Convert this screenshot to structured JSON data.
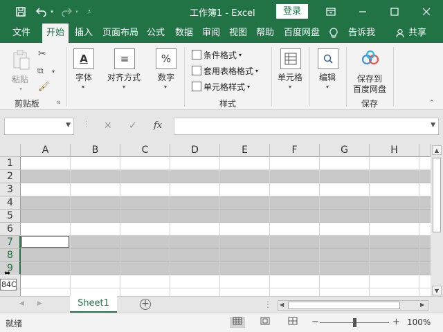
{
  "app": {
    "title": "工作簿1 - Excel",
    "login_label": "登录"
  },
  "quick_access": [
    "save-icon",
    "undo-icon",
    "redo-icon",
    "customize-icon"
  ],
  "window_controls": [
    "ribbon-display-icon",
    "minimize-icon",
    "maximize-icon",
    "close-icon"
  ],
  "tabs": [
    {
      "label": "文件"
    },
    {
      "label": "开始",
      "active": true
    },
    {
      "label": "插入"
    },
    {
      "label": "页面布局"
    },
    {
      "label": "公式"
    },
    {
      "label": "数据"
    },
    {
      "label": "审阅"
    },
    {
      "label": "视图"
    },
    {
      "label": "帮助"
    },
    {
      "label": "百度网盘"
    },
    {
      "label": "告诉我"
    },
    {
      "label": "共享"
    }
  ],
  "ribbon": {
    "clipboard": {
      "paste_label": "粘贴",
      "group_label": "剪贴板"
    },
    "font": {
      "label": "字体",
      "icon_glyph": "A"
    },
    "alignment": {
      "label": "对齐方式",
      "icon_glyph": "≡"
    },
    "number": {
      "label": "数字",
      "icon_glyph": "%"
    },
    "styles": {
      "conditional_format": "条件格式",
      "table_format": "套用表格格式",
      "cell_styles": "单元格样式",
      "group_label": "样式"
    },
    "cells": {
      "label": "单元格"
    },
    "editing": {
      "label": "编辑"
    },
    "save": {
      "label_line1": "保存到",
      "label_line2": "百度网盘",
      "group_label": "保存"
    }
  },
  "formula_bar": {
    "name_box_value": "",
    "cancel_glyph": "✕",
    "enter_glyph": "✓",
    "fx_glyph": "fx",
    "formula_value": ""
  },
  "grid": {
    "columns": [
      "A",
      "B",
      "C",
      "D",
      "E",
      "F",
      "G",
      "H"
    ],
    "rows": [
      "1",
      "2",
      "3",
      "4",
      "5",
      "6",
      "7",
      "8",
      "9"
    ],
    "gray_rows": [
      "2",
      "4",
      "5",
      "7",
      "8",
      "9"
    ],
    "selected_rows": [
      "7",
      "8",
      "9"
    ],
    "active_cell_row": "7",
    "active_cell_col": "A",
    "row_height_tooltip": "84C"
  },
  "sheets": [
    {
      "label": "Sheet1",
      "active": true
    }
  ],
  "status": {
    "ready_label": "就绪",
    "zoom_label": "100%",
    "zoom_percent": 100
  },
  "colors": {
    "accent": "#217346",
    "row_fill": "#c8c8c8",
    "ribbon_bg": "#f3f3f3"
  }
}
